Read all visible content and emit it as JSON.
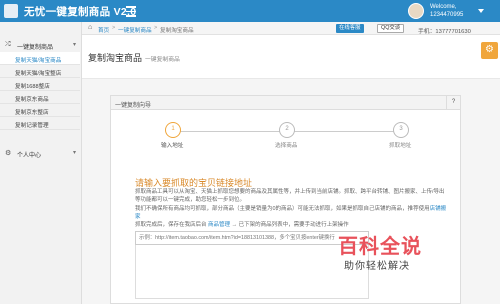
{
  "app": {
    "title": "无忧一键复制商品 V2.0"
  },
  "user": {
    "welcome": "Welcome,",
    "id": "1234470995"
  },
  "sidebar": {
    "group1": {
      "label": "一键复制商品"
    },
    "items": [
      {
        "label": "复制天猫/淘宝商品"
      },
      {
        "label": "复制天猫/淘宝整店"
      },
      {
        "label": "复制1688整店"
      },
      {
        "label": "复制京东商品"
      },
      {
        "label": "复制京东整店"
      },
      {
        "label": "复制记录管理"
      }
    ],
    "group2": {
      "label": "个人中心"
    }
  },
  "breadcrumb": {
    "home": "首页",
    "level1": "一键复制商品",
    "level2": "复制淘宝商品"
  },
  "header_actions": {
    "online": "在线客服",
    "qq": "QQ交谈",
    "phone": "手机：13777701630"
  },
  "page": {
    "title": "复制淘宝商品",
    "subtitle": "一键复制商品"
  },
  "wizard": {
    "title": "一键复制向导",
    "help": "?",
    "steps": [
      {
        "num": "1",
        "label": "输入地址"
      },
      {
        "num": "2",
        "label": "选择商品"
      },
      {
        "num": "3",
        "label": "抓取地址"
      }
    ],
    "prompt": "请输入要抓取的宝贝链接地址",
    "desc1": "抓取商品工具可以从淘宝、天猫上抓取您想要的商品及其属性等，并上传到当前店铺。抓取、跨平台转铺、图片搬家、上传/导出等功能都可以一键完成，助您轻松一步到位。",
    "desc2a": "我们不确保所有商品均可抓取，部分商品（主要是销量为0的商品）可能无法抓取，如果是抓取自己店铺的商品，推荐使用",
    "desc2_link": "店铺搬家",
    "desc3a": "抓取完成后，保存在我店后台",
    "desc3_link": "商品管理",
    "desc3b": "→ 已下架的商品列表中，需要手动进行上架操作",
    "input_placeholder": "示例：http://item.taobao.com/item.htm?id=18813101388，多个宝贝按enter键换行"
  },
  "watermark": {
    "line1": "百科全说",
    "line2": "助你轻松解决"
  },
  "colors": {
    "primary": "#2b89c6",
    "accent": "#f0a63c",
    "watermark": "#e8525b"
  }
}
